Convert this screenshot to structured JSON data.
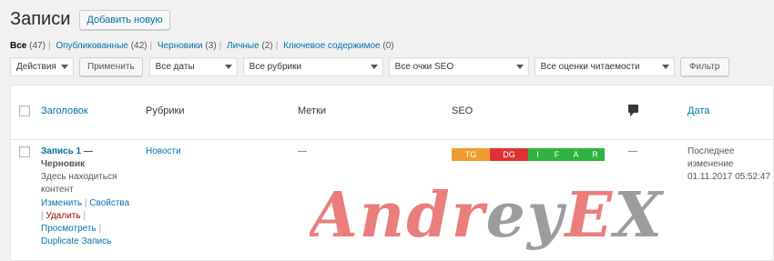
{
  "header": {
    "title": "Записи",
    "add_new": "Добавить новую"
  },
  "views": [
    {
      "label": "Все",
      "count": "(47)"
    },
    {
      "label": "Опубликованные",
      "count": "(42)"
    },
    {
      "label": "Черновики",
      "count": "(3)"
    },
    {
      "label": "Личные",
      "count": "(2)"
    },
    {
      "label": "Ключевое содержимое",
      "count": "(0)"
    }
  ],
  "filters": {
    "bulk_action": "Действия",
    "apply": "Применить",
    "dates": "Все даты",
    "categories": "Все рубрики",
    "seo": "Все очки SEO",
    "readability": "Все оценки читаемости",
    "filter": "Фильтр"
  },
  "columns": {
    "title": "Заголовок",
    "categories": "Рубрики",
    "tags": "Метки",
    "seo": "SEO",
    "date": "Дата"
  },
  "post": {
    "title": "Запись 1",
    "title_dash": " —",
    "state": "Черновик",
    "excerpt_line1": "Здесь находиться",
    "excerpt_line2": "контент",
    "actions": {
      "edit": "Изменить",
      "properties": "Свойства",
      "delete": "Удалить",
      "view": "Просмотреть",
      "duplicate": "Duplicate Запись"
    },
    "category": "Новости",
    "tags": "—",
    "comments": "—",
    "date_status_1": "Последнее",
    "date_status_2": "изменение",
    "date_value": "01.11.2017 05:52:47",
    "seo_badges": [
      {
        "label": "TG",
        "color": "#ee9c2d"
      },
      {
        "label": "DG",
        "color": "#dc3232"
      },
      {
        "label": "I",
        "color": "#2eb33e"
      },
      {
        "label": "F",
        "color": "#2eb33e"
      },
      {
        "label": "A",
        "color": "#2eb33e"
      },
      {
        "label": "R",
        "color": "#2eb33e"
      }
    ]
  },
  "watermark": {
    "text": "AndreyEX",
    "color_accent": "#e8716f",
    "color_muted": "#8b8b8b"
  }
}
